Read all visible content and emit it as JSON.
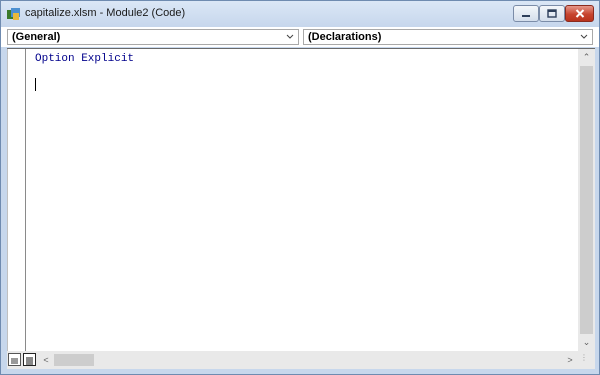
{
  "window": {
    "title": "capitalize.xlsm - Module2 (Code)",
    "icon": "vba-module-icon",
    "controls": {
      "minimize": "minimize-icon",
      "maximize": "maximize-icon",
      "close": "close-icon"
    }
  },
  "dropdowns": {
    "object": {
      "value": "(General)"
    },
    "procedure": {
      "value": "(Declarations)"
    }
  },
  "code": {
    "lines": [
      "Option Explicit",
      ""
    ]
  },
  "colors": {
    "keyword": "#00008b",
    "title_bar": "#c6d6ec",
    "close_button": "#c7442f"
  },
  "bottom_bar": {
    "procedure_view_icon": "procedure-view-icon",
    "full_module_view_icon": "full-module-view-icon"
  }
}
